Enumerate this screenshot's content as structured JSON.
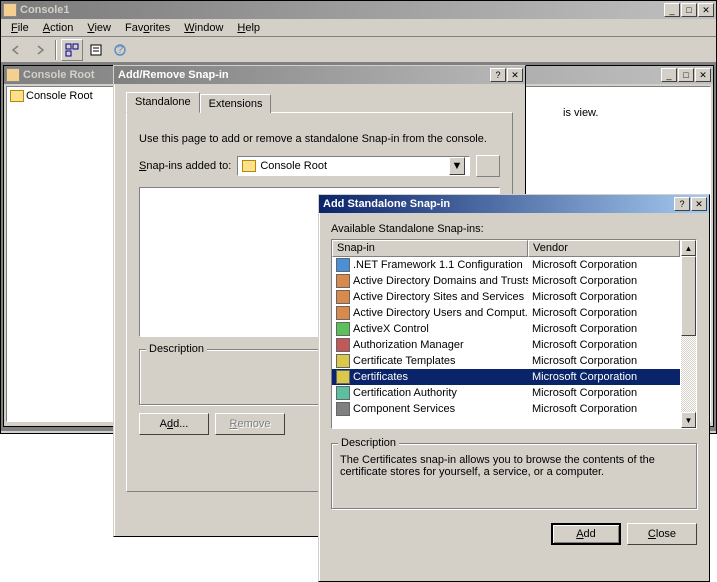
{
  "main": {
    "title": "Console1",
    "menus": [
      "File",
      "Action",
      "View",
      "Favorites",
      "Window",
      "Help"
    ]
  },
  "child": {
    "title": "Console Root",
    "tree_root": "Console Root",
    "empty_text": "is view."
  },
  "dialog1": {
    "title": "Add/Remove Snap-in",
    "tabs": [
      "Standalone",
      "Extensions"
    ],
    "intro": "Use this page to add or remove a standalone Snap-in from the console.",
    "snapins_label": "Snap-ins added to:",
    "combo_value": "Console Root",
    "description_label": "Description",
    "add_btn": "Add...",
    "remove_btn": "Remove"
  },
  "dialog2": {
    "title": "Add Standalone Snap-in",
    "available_label": "Available Standalone Snap-ins:",
    "columns": [
      "Snap-in",
      "Vendor"
    ],
    "rows": [
      {
        "name": ".NET Framework 1.1 Configuration",
        "vendor": "Microsoft Corporation"
      },
      {
        "name": "Active Directory Domains and Trusts",
        "vendor": "Microsoft Corporation"
      },
      {
        "name": "Active Directory Sites and Services",
        "vendor": "Microsoft Corporation"
      },
      {
        "name": "Active Directory Users and Comput...",
        "vendor": "Microsoft Corporation"
      },
      {
        "name": "ActiveX Control",
        "vendor": "Microsoft Corporation"
      },
      {
        "name": "Authorization Manager",
        "vendor": "Microsoft Corporation"
      },
      {
        "name": "Certificate Templates",
        "vendor": "Microsoft Corporation"
      },
      {
        "name": "Certificates",
        "vendor": "Microsoft Corporation",
        "selected": true
      },
      {
        "name": "Certification Authority",
        "vendor": "Microsoft Corporation"
      },
      {
        "name": "Component Services",
        "vendor": "Microsoft Corporation"
      }
    ],
    "description_label": "Description",
    "description_text": "The Certificates snap-in allows you to browse the contents of the certificate stores for yourself, a service, or a computer.",
    "add_btn": "Add",
    "close_btn": "Close"
  }
}
